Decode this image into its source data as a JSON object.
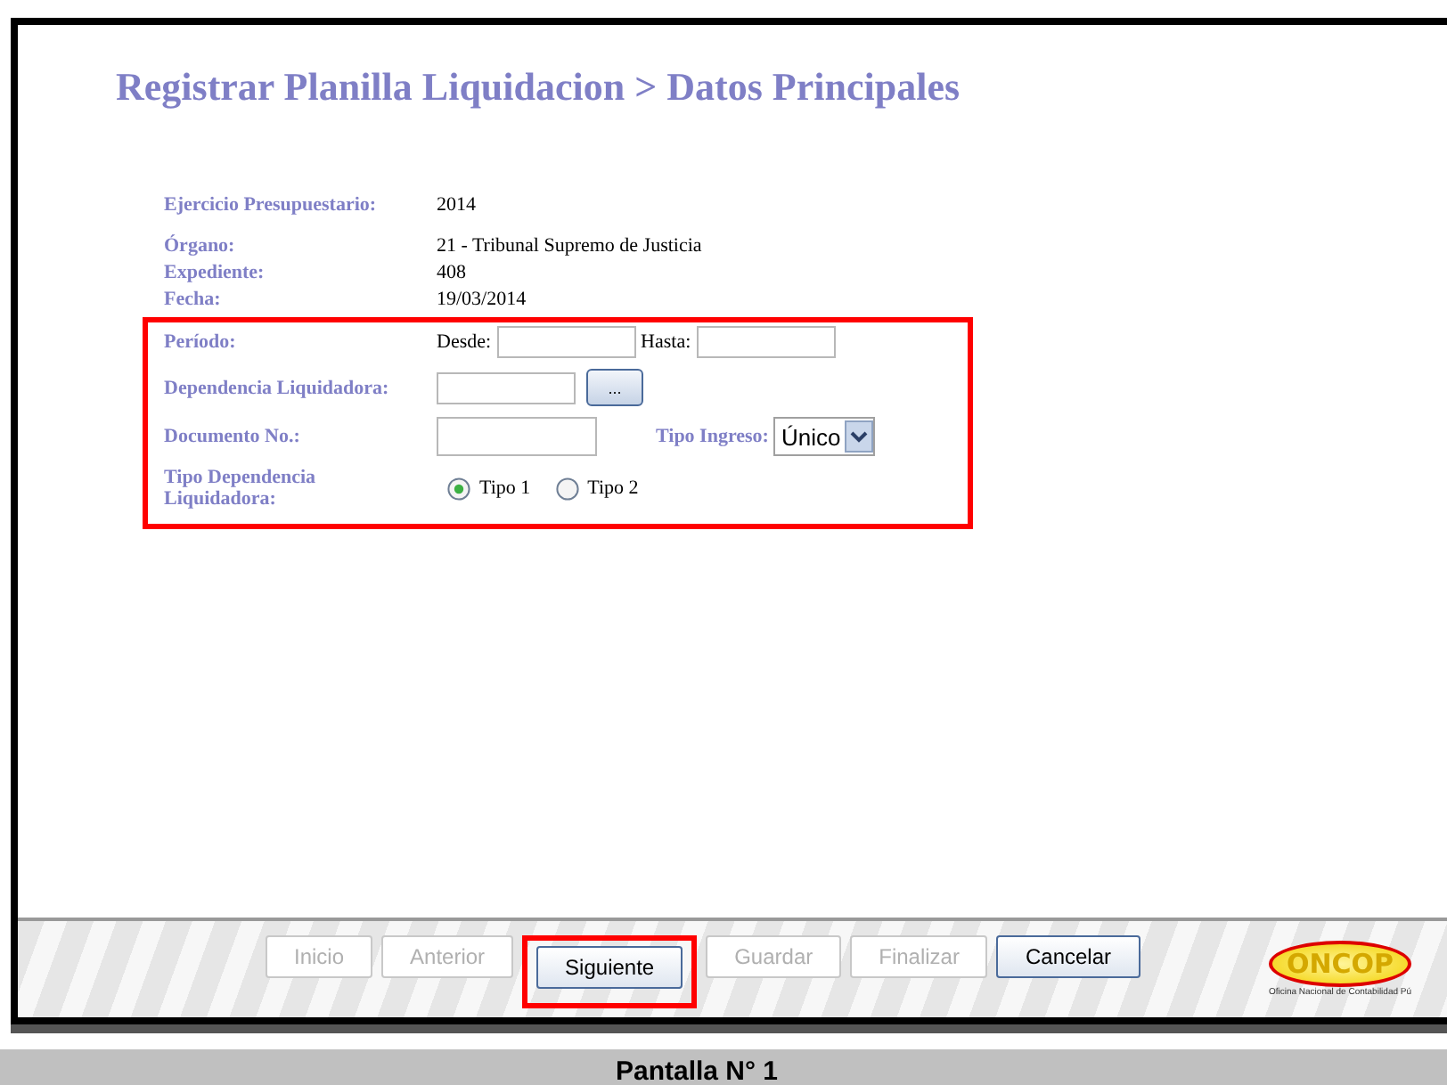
{
  "title": "Registrar Planilla Liquidacion > Datos Principales",
  "info": [
    {
      "label": "Ejercicio Presupuestario:",
      "value": "2014"
    },
    {
      "label": "Órgano:",
      "value": "21 - Tribunal Supremo de Justicia"
    },
    {
      "label": "Expediente:",
      "value": "408"
    },
    {
      "label": "Fecha:",
      "value": "19/03/2014"
    }
  ],
  "form": {
    "highlighted": true,
    "periodo": {
      "label": "Período:",
      "desde_label": "Desde:",
      "hasta_label": "Hasta:"
    },
    "dependencia": {
      "label": "Dependencia Liquidadora:",
      "button": "..."
    },
    "documento": {
      "label": "Documento No.:"
    },
    "tipo_ingreso": {
      "label": "Tipo Ingreso:",
      "value": "Único"
    },
    "tipo_dependencia": {
      "label": "Tipo Dependencia Liquidadora:",
      "options": [
        {
          "label": "Tipo 1",
          "selected": true
        },
        {
          "label": "Tipo 2",
          "selected": false
        }
      ]
    }
  },
  "buttons": [
    {
      "label": "Inicio",
      "disabled": true,
      "highlighted": false
    },
    {
      "label": "Anterior",
      "disabled": true,
      "highlighted": false
    },
    {
      "label": "Siguiente",
      "disabled": false,
      "highlighted": true
    },
    {
      "label": "Guardar",
      "disabled": true,
      "highlighted": false
    },
    {
      "label": "Finalizar",
      "disabled": true,
      "highlighted": false
    },
    {
      "label": "Cancelar",
      "disabled": false,
      "highlighted": false
    }
  ],
  "logo": {
    "name": "ONCOP",
    "subtitle": "Oficina Nacional de Contabilidad Pú"
  },
  "caption": "Pantalla N° 1"
}
